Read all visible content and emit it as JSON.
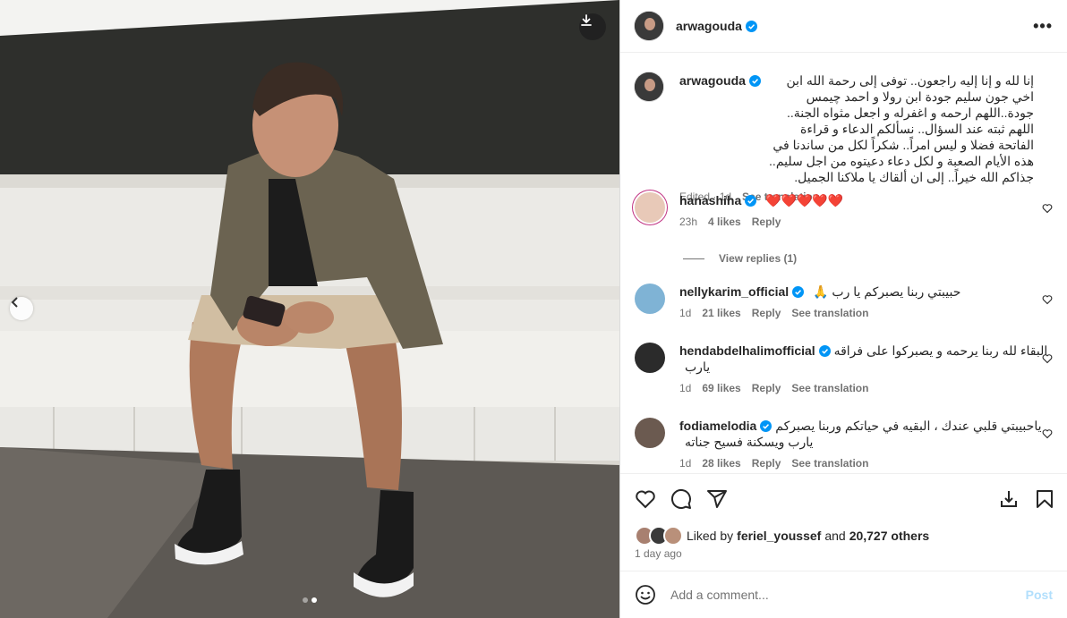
{
  "post": {
    "username": "arwagouda",
    "dot_count": 2,
    "active_dot": 2
  },
  "header": {
    "more": "•••"
  },
  "caption": {
    "username": "arwagouda",
    "text": "إنا لله و إنا إليه راجعون.. توفى إلى رحمة الله ابن اخي جون سليم جودة ابن رولا و احمد چيمس جودة..اللهم ارحمه و اغفرله و اجعل مثواه الجنة.. اللهم ثبته عند السؤال.. نسألكم الدعاء و قراءة الفاتحة فضلا و ليس امراً.. شكراً لكل من ساندنا في هذه الأيام الصعبة و لكل دعاء دعيتوه من اجل سليم.. جذاكم الله خيراً.. إلى ان ألقاك يا ملاكنا الجميل.",
    "edited": "Edited · 1d",
    "see_translation": "See translation"
  },
  "comments": [
    {
      "username": "hanashiha",
      "text": "❤️❤️❤️❤️❤️",
      "time": "23h",
      "likes": "4 likes",
      "reply": "Reply",
      "translation": "",
      "avatar_color": "#e8c9b8"
    },
    {
      "username": "nellykarim_official",
      "text": "حبيبتي ربنا يصبركم يا رب 🙏",
      "time": "1d",
      "likes": "21 likes",
      "reply": "Reply",
      "translation": "See translation",
      "avatar_color": "#7fb3d5"
    },
    {
      "username": "hendabdelhalimofficial",
      "text": "البقاء لله ربنا يرحمه و يصبركوا على فراقه يارب",
      "time": "1d",
      "likes": "69 likes",
      "reply": "Reply",
      "translation": "See translation",
      "avatar_color": "#2b2b2b"
    },
    {
      "username": "fodiamelodia",
      "text": "ياحبيبتي قلبي عندك ، البقيه في حياتكم وربنا يصبركم يارب ويسكنة فسيح جناته",
      "time": "1d",
      "likes": "28 likes",
      "reply": "Reply",
      "translation": "See translation",
      "avatar_color": "#6b5a50"
    }
  ],
  "view_replies": "View replies (1)",
  "likes": {
    "prefix": "Liked by",
    "user": "feriel_youssef",
    "middle": "and",
    "count": "20,727 others"
  },
  "time_ago": "1 day ago",
  "add_comment": {
    "placeholder": "Add a comment...",
    "post": "Post"
  },
  "colors": {
    "verified": "#0095f6",
    "post_disabled": "#b2dffc",
    "heart": "#ed4956"
  },
  "icons": [
    "download-icon",
    "chevron-left-icon",
    "more-icon",
    "heart-icon",
    "comment-icon",
    "share-icon",
    "save-icon",
    "emoji-icon",
    "verified-icon"
  ]
}
